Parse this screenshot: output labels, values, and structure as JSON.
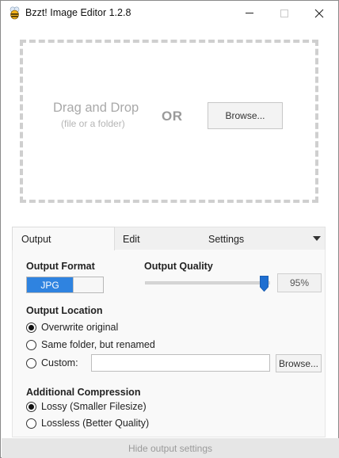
{
  "window": {
    "title": "Bzzt! Image Editor 1.2.8",
    "app_icon": "bee-icon",
    "controls": [
      "minimize-icon",
      "maximize-icon",
      "close-icon"
    ]
  },
  "dropzone": {
    "title": "Drag and Drop",
    "subtitle": "(file or a folder)",
    "or_label": "OR",
    "browse_label": "Browse..."
  },
  "tabs": [
    {
      "label": "Output",
      "selected": true
    },
    {
      "label": "Edit",
      "selected": false
    },
    {
      "label": "Settings",
      "selected": false
    }
  ],
  "output": {
    "format_label": "Output Format",
    "format_value": "JPG",
    "format_toggle_on": true,
    "quality_label": "Output Quality",
    "quality_value": "95%",
    "quality_fraction": 0.95,
    "location_label": "Output Location",
    "location_options": [
      {
        "label": "Overwrite original",
        "checked": true
      },
      {
        "label": "Same folder, but renamed",
        "checked": false
      },
      {
        "label": "Custom:",
        "checked": false
      }
    ],
    "custom_path": "",
    "custom_browse_label": "Browse...",
    "compression_label": "Additional Compression",
    "compression_options": [
      {
        "label": "Lossy (Smaller Filesize)",
        "checked": true
      },
      {
        "label": "Lossless (Better Quality)",
        "checked": false
      }
    ]
  },
  "footer": {
    "toggle_label": "Hide output settings"
  },
  "colors": {
    "accent": "#2f83e0",
    "slider_thumb": "#1f6fd1",
    "footer_bg": "#e6e6e6"
  }
}
